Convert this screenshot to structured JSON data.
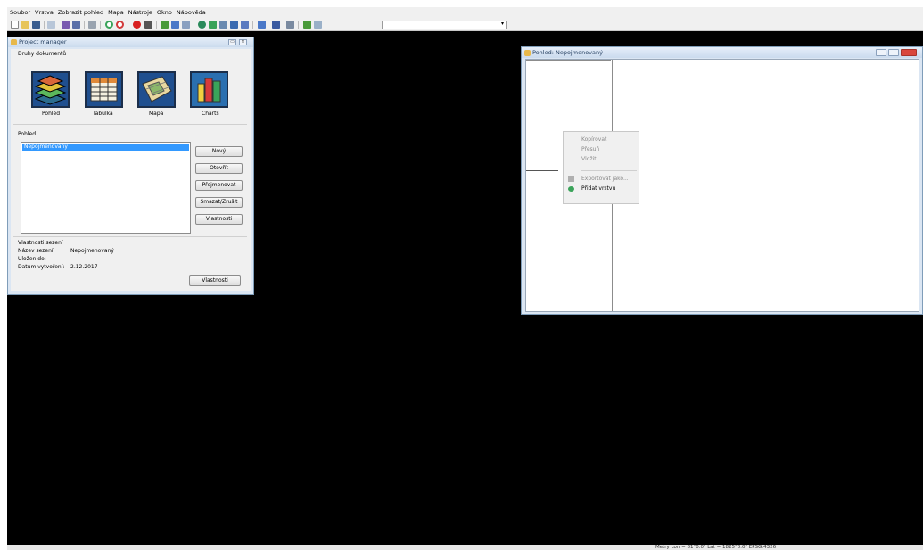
{
  "menubar": {
    "items": [
      "Soubor",
      "Vrstva",
      "Zobrazit pohled",
      "Mapa",
      "Nástroje",
      "Okno",
      "Nápověda"
    ]
  },
  "toolbar": {
    "icons": [
      "new-doc-icon",
      "open-icon",
      "save-icon",
      "preview-icon",
      "print-icon",
      "print2-icon",
      "link-icon",
      "zoom-in-icon",
      "zoom-out-icon",
      "stop-icon",
      "pan-icon",
      "add-layer-icon",
      "table-icon",
      "info-icon",
      "globe-icon",
      "layers-icon",
      "grid-icon",
      "select-icon",
      "book-icon",
      "grid2-icon",
      "db-icon",
      "settings-icon",
      "map-icon"
    ],
    "scale_combo_value": ""
  },
  "project_manager": {
    "title": "Project manager",
    "doc_types_label": "Druhy dokumentů",
    "doc_types": [
      {
        "label": "Pohled",
        "icon": "layers-doc-icon"
      },
      {
        "label": "Tabulka",
        "icon": "table-doc-icon"
      },
      {
        "label": "Mapa",
        "icon": "map-doc-icon"
      },
      {
        "label": "Charts",
        "icon": "chart-doc-icon"
      }
    ],
    "section_label": "Pohled",
    "list_items": [
      "Nepojmenovaný"
    ],
    "buttons": {
      "new": "Nový",
      "open": "Otevřít",
      "rename": "Přejmenovat",
      "delete": "Smazat/Zrušit",
      "properties": "Vlastnosti"
    },
    "session": {
      "label": "Vlastnosti sezení",
      "name_label": "Název sezení:",
      "name_value": "Nepojmenovaný",
      "saved_label": "Uložen do:",
      "saved_value": "",
      "created_label": "Datum vytvoření:",
      "created_value": "2.12.2017",
      "properties_button": "Vlastnosti"
    }
  },
  "view_window": {
    "title": "Pohled: Nepojmenovaný",
    "context_menu": {
      "items": [
        {
          "label": "Kopírovat",
          "enabled": false
        },
        {
          "label": "Přesuň",
          "enabled": false
        },
        {
          "label": "Vložit",
          "enabled": false
        },
        {
          "label": "Exportovat jako...",
          "enabled": false
        },
        {
          "label": "Přidat vrstvu",
          "enabled": true
        }
      ]
    }
  },
  "statusbar": {
    "text": "Metry Lon = 81°0.0\"  Lat = 1825°0.0\"  EPSG:4326"
  },
  "colors": {
    "desktop": "#000000",
    "selection": "#3399ff",
    "tile_blue": "#1f4f8f",
    "window_frame": "#dbe6f3"
  }
}
